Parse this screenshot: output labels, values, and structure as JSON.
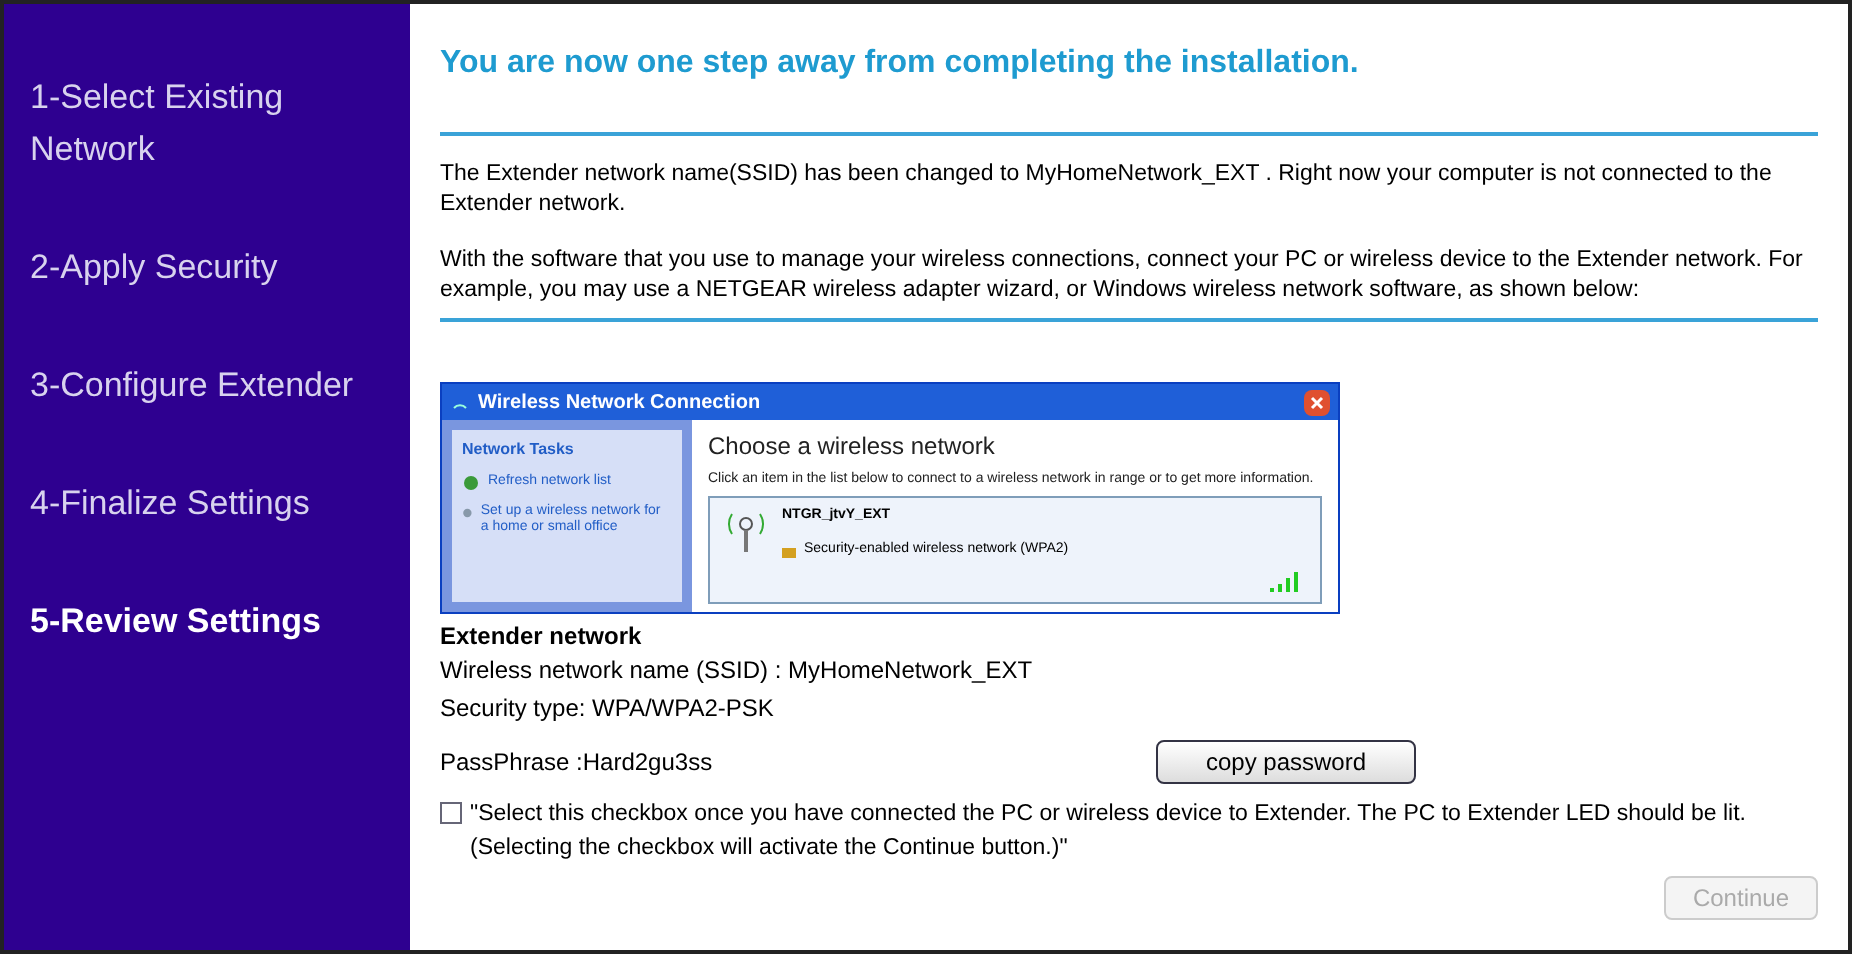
{
  "steps": [
    {
      "label": "1-Select Existing Network",
      "selected": false
    },
    {
      "label": "2-Apply Security",
      "selected": false
    },
    {
      "label": "3-Configure Extender",
      "selected": false
    },
    {
      "label": "4-Finalize Settings",
      "selected": false
    },
    {
      "label": "5-Review Settings",
      "selected": true
    }
  ],
  "heading": "You are now one step away from completing the installation.",
  "paragraphs": [
    "The Extender network name(SSID) has been changed to MyHomeNetwork_EXT . Right now your computer is not connected to the Extender network.",
    "With the software that you use to manage your wireless connections, connect your PC or wireless device to the Extender network. For example, you may use a NETGEAR wireless adapter wizard, or Windows wireless network software, as shown below:"
  ],
  "example_window": {
    "title": "Wireless Network Connection",
    "tasks_title": "Network Tasks",
    "tasks": [
      "Refresh network list",
      "Set up a wireless network for a home or small office"
    ],
    "heading": "Choose a wireless network",
    "hint": "Click an item in the list below to connect to a wireless network in range or to get more information.",
    "network": {
      "name": "NTGR_jtvY_EXT",
      "security": "Security-enabled wireless network (WPA2)"
    }
  },
  "extender": {
    "title": "Extender network",
    "ssid": "Wireless network name (SSID) : MyHomeNetwork_EXT",
    "security": "Security type: WPA/WPA2-PSK",
    "passphrase": "PassPhrase :Hard2gu3ss",
    "copy_button": "copy password"
  },
  "confirm": {
    "checked": false,
    "text": "\"Select this checkbox once you have connected the PC or wireless device to Extender. The PC to Extender LED should be lit. (Selecting the checkbox will activate the Continue button.)\""
  },
  "continue_button": {
    "label": "Continue",
    "disabled": true
  }
}
